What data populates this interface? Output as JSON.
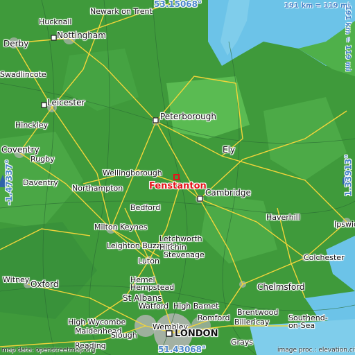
{
  "map": {
    "target": "Fenstanton",
    "coords": {
      "north": "53.15068°",
      "south": "51.43068°",
      "west": "-1.47337°",
      "east": "1.33913°"
    },
    "scale_top": "191 km = 119 mi",
    "scale_right": "191 km = 119 mi",
    "credit_left": "map data: openstreetmap.org",
    "credit_right": "image proc.: elevation.city",
    "colors": {
      "land": "#3f9a3b",
      "lowland": "#4fb04a",
      "water": "#6cc3e8",
      "road": "#f3d53a",
      "urban": "#b5b5b5",
      "marker": "#e4141b"
    },
    "places": [
      "Hucknall",
      "Newark on Trent",
      "Nottingham",
      "Derby",
      "Swadlincote",
      "Leicester",
      "Hinckley",
      "Coventry",
      "Rugby",
      "Daventry",
      "Northampton",
      "Wellingborough",
      "Peterborough",
      "Ely",
      "Cambridge",
      "Bedford",
      "Milton Keynes",
      "Leighton Buzzard",
      "Letchworth",
      "Hitchin",
      "Stevenage",
      "Luton",
      "Haverhill",
      "Ipswich",
      "Colchester",
      "Oxford",
      "Witney",
      "Hemel Hempstead",
      "St Albans",
      "Watford",
      "High Barnet",
      "Chelmsford",
      "Brentwood",
      "Billericay",
      "Romford",
      "Southend-on-Sea",
      "High Wycombe",
      "Maidenhead",
      "Slough",
      "Reading",
      "Wembley",
      "Grays",
      "LONDON"
    ]
  }
}
